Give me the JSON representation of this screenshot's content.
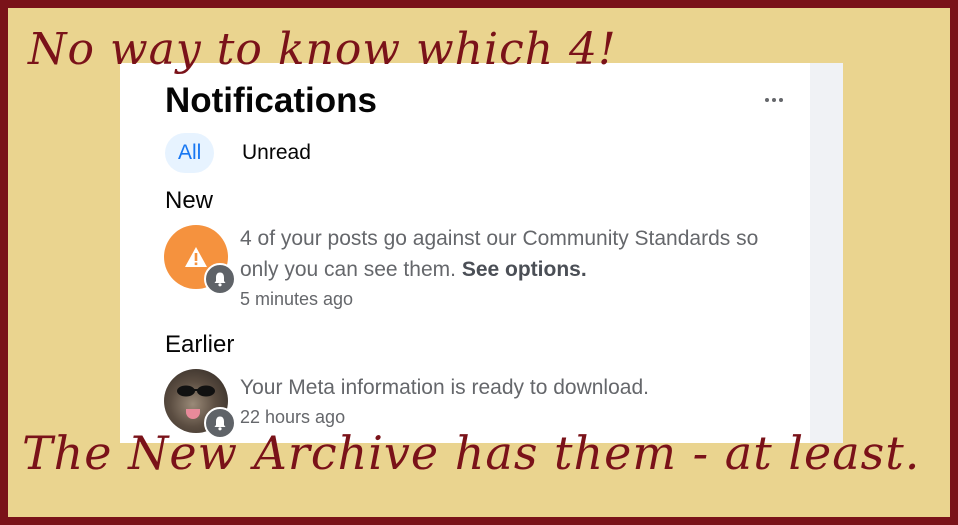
{
  "captions": {
    "top": "No way to know which 4!",
    "bottom": "The New Archive has them - at least."
  },
  "panel": {
    "title": "Notifications",
    "tabs": [
      {
        "label": "All",
        "active": true
      },
      {
        "label": "Unread",
        "active": false
      }
    ],
    "sections": {
      "new": "New",
      "earlier": "Earlier"
    },
    "notifications": [
      {
        "text": "4 of your posts go against our Community Standards so only you can see them.",
        "action": "See options.",
        "time": "5 minutes ago",
        "icon": "warning-icon",
        "badge_icon": "bell-icon"
      },
      {
        "text": "Your Meta information is ready to download.",
        "time": "22 hours ago",
        "icon": "dog-avatar",
        "badge_icon": "bell-icon"
      }
    ]
  },
  "colors": {
    "frame": "#7a1219",
    "background": "#ead48f",
    "accent": "#1877f2",
    "warning": "#f5923e"
  }
}
